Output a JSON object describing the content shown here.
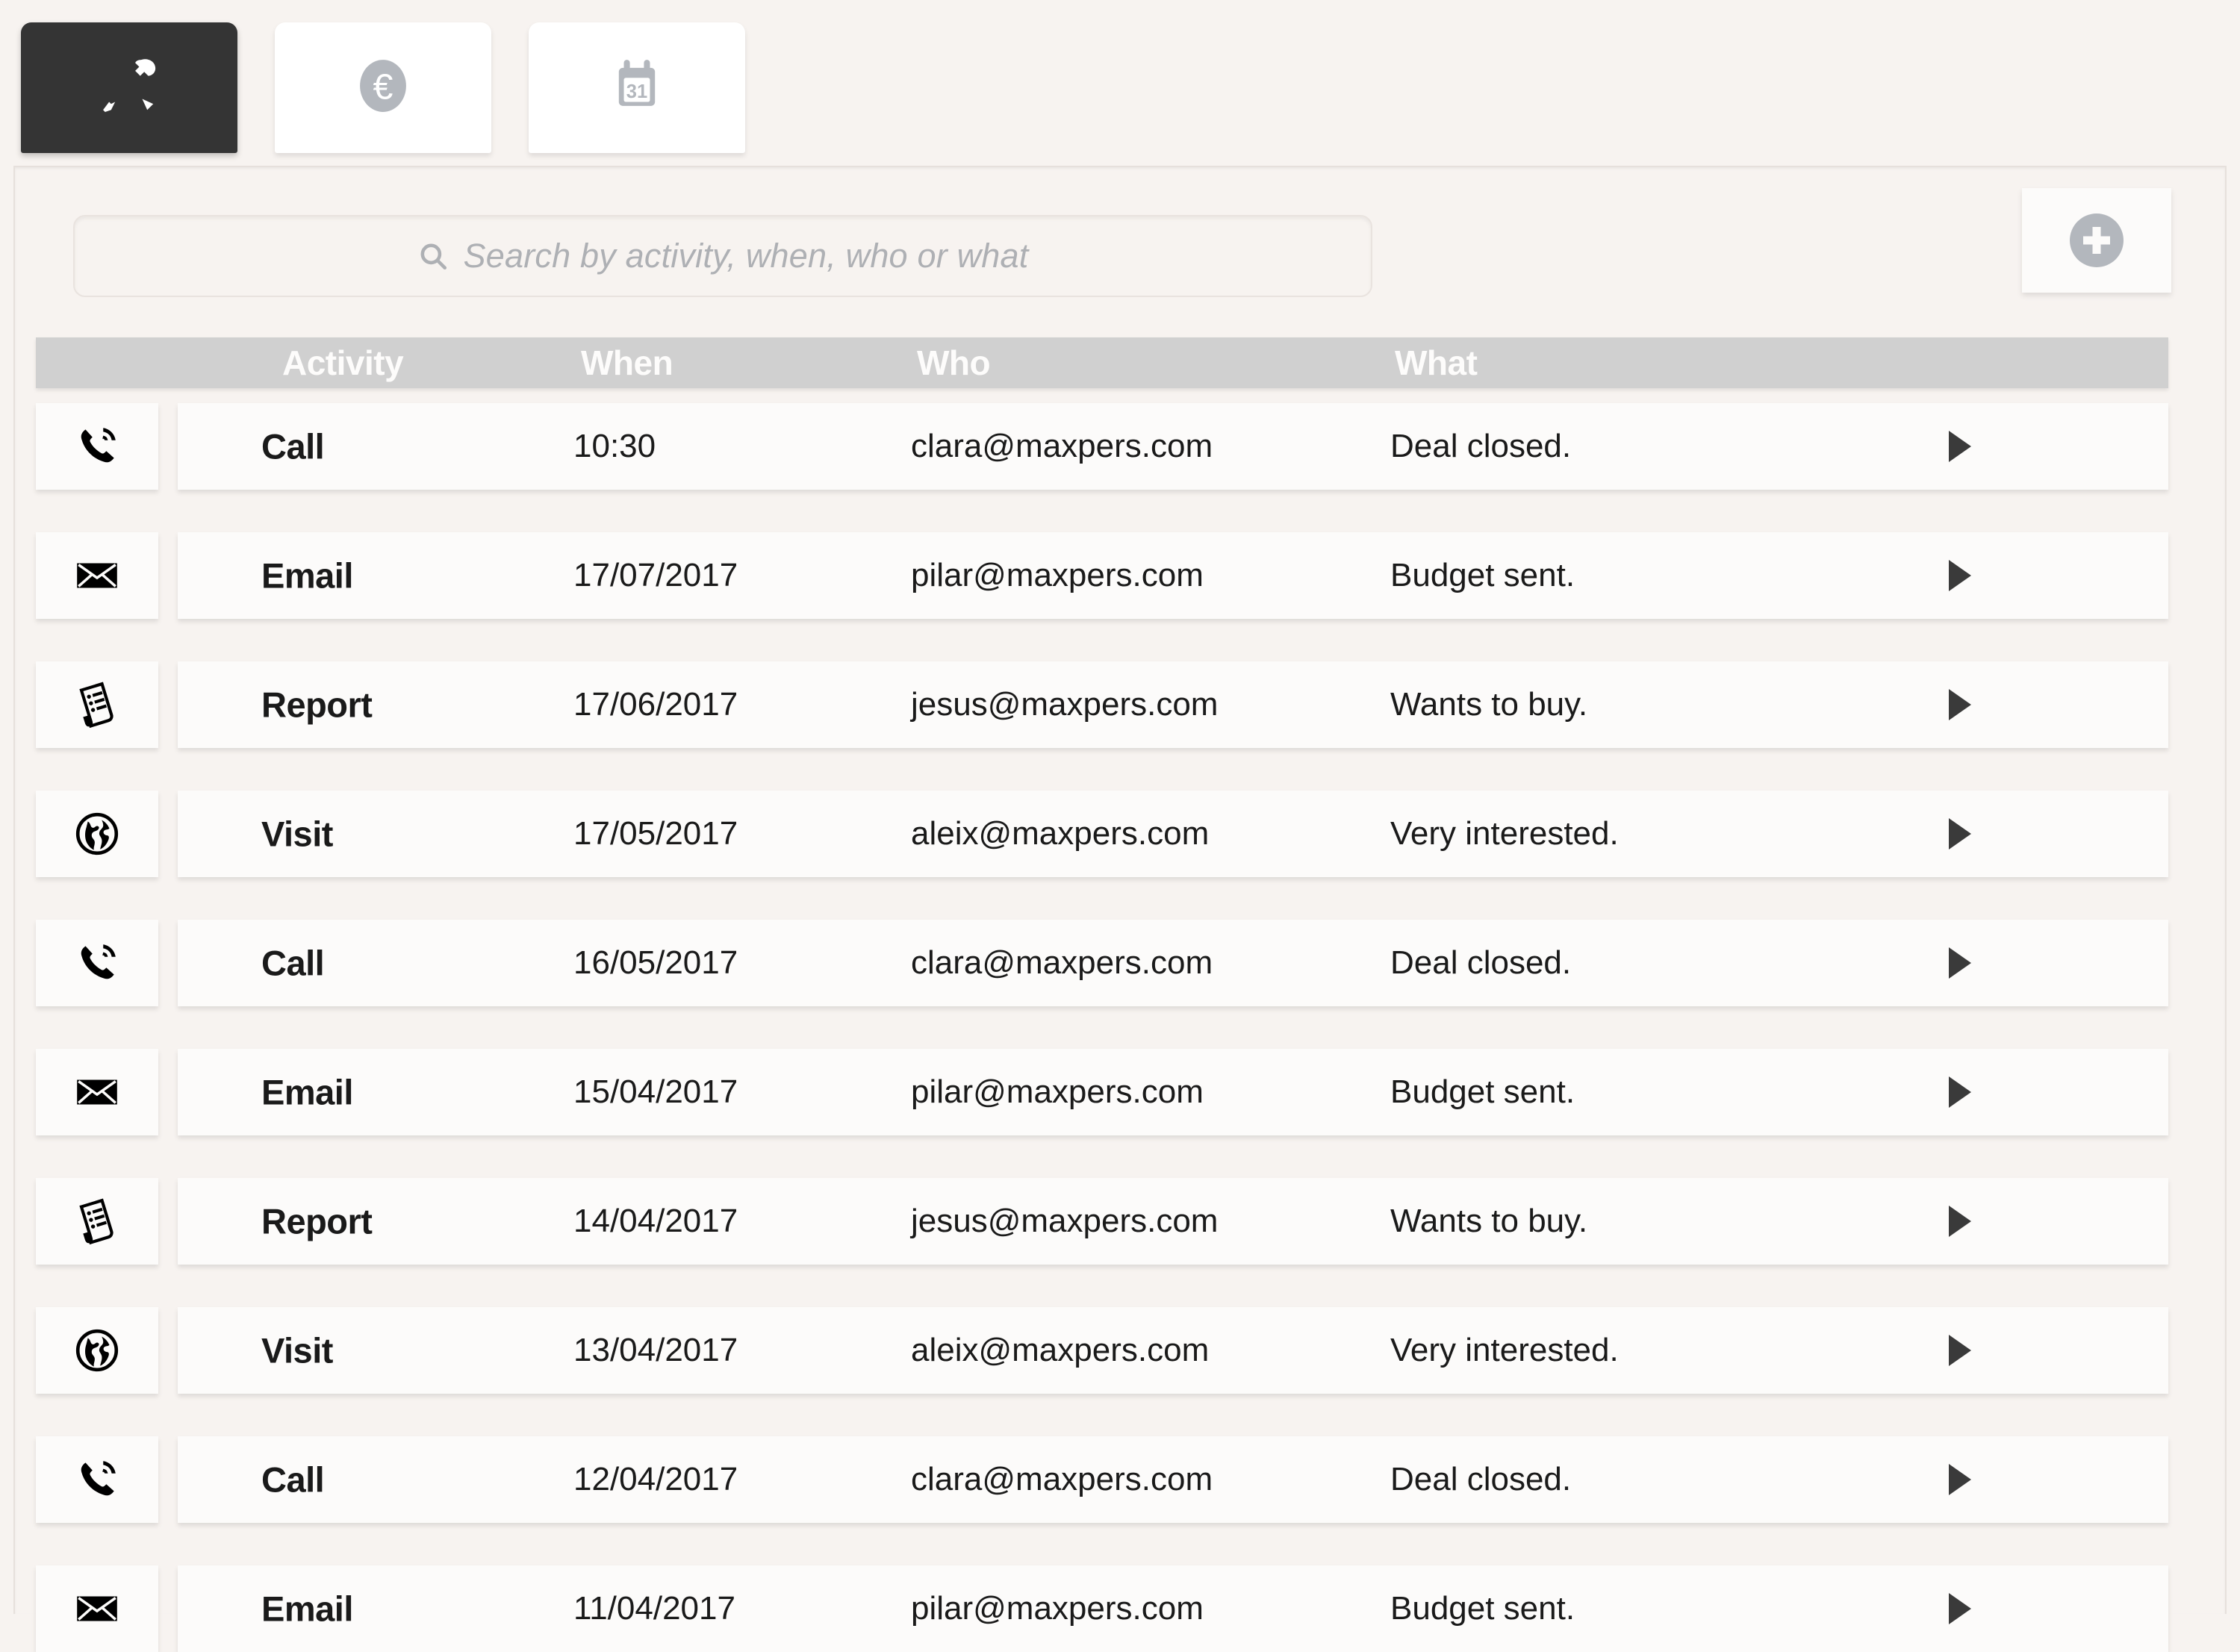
{
  "tabs": [
    {
      "id": "tools",
      "icon": "tools-icon",
      "active": true
    },
    {
      "id": "money",
      "icon": "euro-icon",
      "active": false
    },
    {
      "id": "calendar",
      "icon": "calendar-icon",
      "active": false,
      "day": "31"
    }
  ],
  "search": {
    "placeholder": "Search by activity, when, who or what",
    "value": "",
    "icon": "search-icon"
  },
  "add_button": {
    "icon": "plus-icon",
    "label": ""
  },
  "table": {
    "headers": {
      "icon": "",
      "activity": "Activity",
      "when": "When",
      "who": "Who",
      "what": "What"
    },
    "rows": [
      {
        "icon": "phone-icon",
        "activity": "Call",
        "when": "10:30",
        "who": "clara@maxpers.com",
        "what": "Deal closed.",
        "arrow": "chevron-right-icon"
      },
      {
        "icon": "envelope-icon",
        "activity": "Email",
        "when": "17/07/2017",
        "who": "pilar@maxpers.com",
        "what": "Budget sent.",
        "arrow": "chevron-right-icon"
      },
      {
        "icon": "report-icon",
        "activity": "Report",
        "when": "17/06/2017",
        "who": "jesus@maxpers.com",
        "what": "Wants to buy.",
        "arrow": "chevron-right-icon"
      },
      {
        "icon": "globe-icon",
        "activity": "Visit",
        "when": "17/05/2017",
        "who": "aleix@maxpers.com",
        "what": "Very interested.",
        "arrow": "chevron-right-icon"
      },
      {
        "icon": "phone-icon",
        "activity": "Call",
        "when": "16/05/2017",
        "who": "clara@maxpers.com",
        "what": "Deal closed.",
        "arrow": "chevron-right-icon"
      },
      {
        "icon": "envelope-icon",
        "activity": "Email",
        "when": "15/04/2017",
        "who": "pilar@maxpers.com",
        "what": "Budget sent.",
        "arrow": "chevron-right-icon"
      },
      {
        "icon": "report-icon",
        "activity": "Report",
        "when": "14/04/2017",
        "who": "jesus@maxpers.com",
        "what": "Wants to buy.",
        "arrow": "chevron-right-icon"
      },
      {
        "icon": "globe-icon",
        "activity": "Visit",
        "when": "13/04/2017",
        "who": "aleix@maxpers.com",
        "what": "Very interested.",
        "arrow": "chevron-right-icon"
      },
      {
        "icon": "phone-icon",
        "activity": "Call",
        "when": "12/04/2017",
        "who": "clara@maxpers.com",
        "what": "Deal closed.",
        "arrow": "chevron-right-icon"
      },
      {
        "icon": "envelope-icon",
        "activity": "Email",
        "when": "11/04/2017",
        "who": "pilar@maxpers.com",
        "what": "Budget sent.",
        "arrow": "chevron-right-icon"
      }
    ]
  },
  "colors": {
    "background": "#f7f3f0",
    "card": "#fcfbfa",
    "active_tab": "#343434",
    "header_bar": "#d0d0d0",
    "muted_gray": "#b3b7bd",
    "text": "#1a1a1a"
  }
}
